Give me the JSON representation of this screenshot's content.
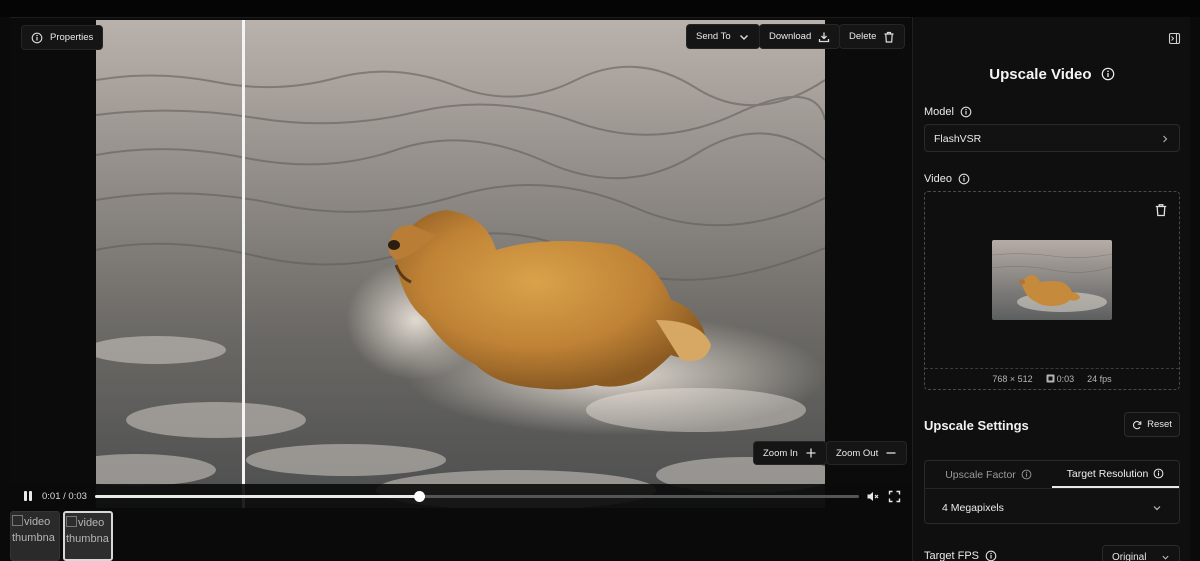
{
  "viewer": {
    "properties_label": "Properties",
    "send_to_label": "Send To",
    "download_label": "Download",
    "delete_label": "Delete",
    "zoom_in_label": "Zoom In",
    "zoom_out_label": "Zoom Out",
    "split_compare_position": 0.2
  },
  "player": {
    "time_display": "0:01 / 0:03",
    "progress": 0.424
  },
  "thumbnails": [
    {
      "alt": "video thumbna",
      "active": false
    },
    {
      "alt": "video thumbna",
      "active": true
    }
  ],
  "panel": {
    "title": "Upscale Video",
    "model_label": "Model",
    "model_value": "FlashVSR",
    "video_label": "Video",
    "video_meta": {
      "dimensions": "768 × 512",
      "duration": "0:03",
      "fps": "24 fps"
    },
    "settings_title": "Upscale Settings",
    "reset_label": "Reset",
    "tabs": [
      {
        "label": "Upscale Factor",
        "active": false
      },
      {
        "label": "Target Resolution",
        "active": true
      }
    ],
    "target_resolution_value": "4 Megapixels",
    "target_fps_label": "Target FPS",
    "target_fps_value": "Original"
  },
  "icons": {
    "properties": "info-circle-icon",
    "send_to": "chevron-down-icon",
    "download": "download-icon",
    "delete": "trash-icon",
    "zoom_in": "plus-icon",
    "zoom_out": "minus-icon",
    "play_pause": "pause-icon",
    "mute": "mute-icon",
    "fullscreen": "fullscreen-icon",
    "collapse": "panel-collapse-icon"
  }
}
